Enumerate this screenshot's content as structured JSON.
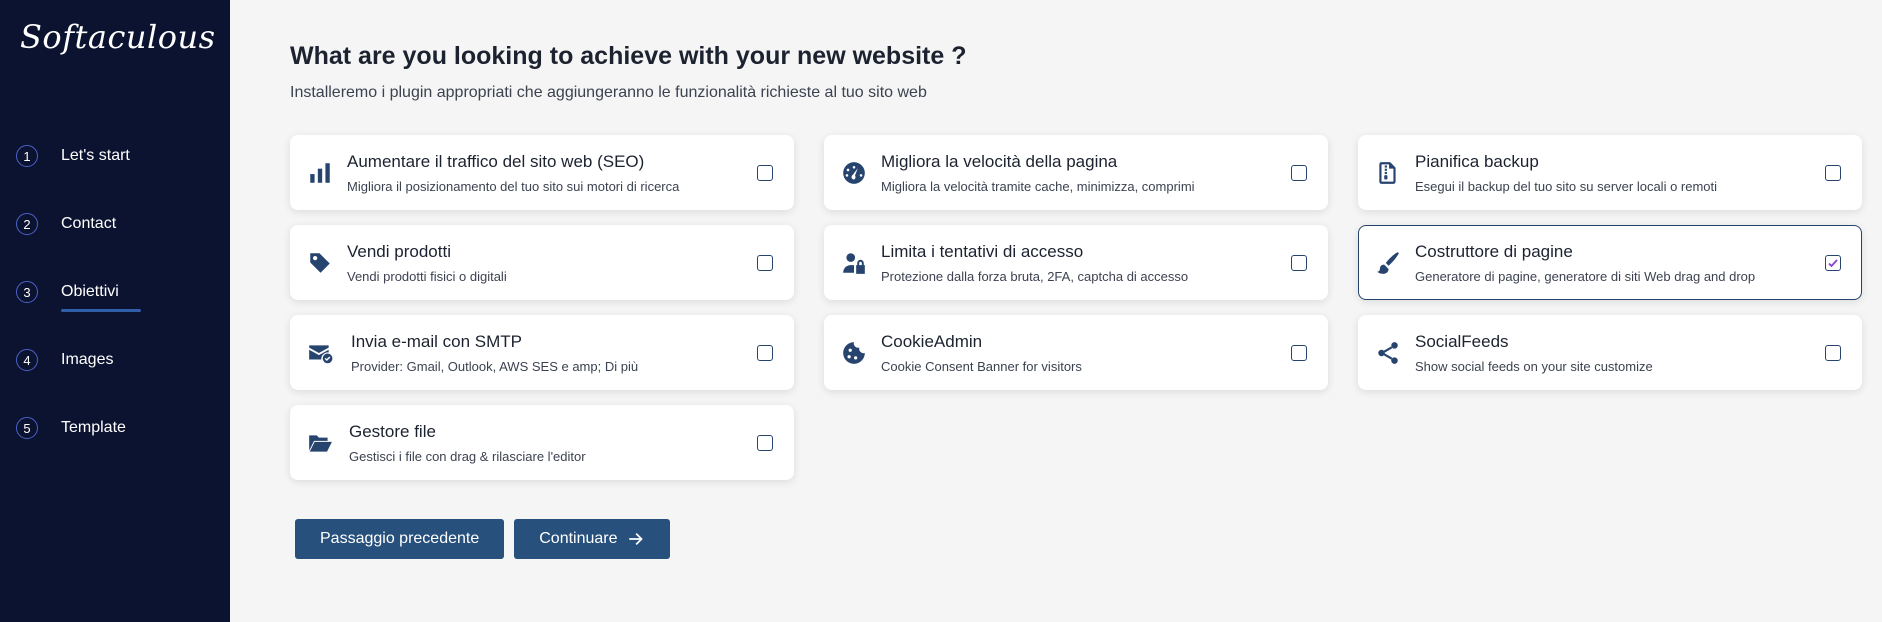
{
  "sidebar": {
    "logo": "Softaculous",
    "steps": [
      {
        "num": "1",
        "label": "Let's start"
      },
      {
        "num": "2",
        "label": "Contact"
      },
      {
        "num": "3",
        "label": "Obiettivi"
      },
      {
        "num": "4",
        "label": "Images"
      },
      {
        "num": "5",
        "label": "Template"
      }
    ],
    "active_step": "Obiettivi"
  },
  "main": {
    "title": "What are you looking to achieve with your new website ?",
    "subtitle": "Installeremo i plugin appropriati che aggiungeranno le funzionalità richieste al tuo sito web",
    "options": [
      {
        "title": "Aumentare il traffico del sito web (SEO)",
        "desc": "Migliora il posizionamento del tuo sito sui motori di ricerca",
        "icon": "bar-chart-icon",
        "checked": false
      },
      {
        "title": "Migliora la velocità della pagina",
        "desc": "Migliora la velocità tramite cache, minimizza, comprimi",
        "icon": "speedometer-icon",
        "checked": false
      },
      {
        "title": "Pianifica backup",
        "desc": "Esegui il backup del tuo sito su server locali o remoti",
        "icon": "file-archive-icon",
        "checked": false
      },
      {
        "title": "Vendi prodotti",
        "desc": "Vendi prodotti fisici o digitali",
        "icon": "tag-icon",
        "checked": false
      },
      {
        "title": "Limita i tentativi di accesso",
        "desc": "Protezione dalla forza bruta, 2FA, captcha di accesso",
        "icon": "user-lock-icon",
        "checked": false
      },
      {
        "title": "Costruttore di pagine",
        "desc": "Generatore di pagine, generatore di siti Web drag and drop",
        "icon": "paintbrush-icon",
        "checked": true
      },
      {
        "title": "Invia e-mail con SMTP",
        "desc": "Provider: Gmail, Outlook, AWS SES e amp; Di più",
        "icon": "envelope-check-icon",
        "checked": false
      },
      {
        "title": "CookieAdmin",
        "desc": "Cookie Consent Banner for visitors",
        "icon": "cookie-icon",
        "checked": false
      },
      {
        "title": "SocialFeeds",
        "desc": "Show social feeds on your site customize",
        "icon": "share-icon",
        "checked": false
      },
      {
        "title": "Gestore file",
        "desc": "Gestisci i file con drag & rilasciare l'editor",
        "icon": "folder-open-icon",
        "checked": false
      }
    ],
    "buttons": {
      "prev": "Passaggio precedente",
      "next": "Continuare"
    }
  },
  "colors": {
    "sidebar_bg": "#0b1330",
    "accent": "#27446e",
    "button_bg": "#27507c",
    "page_bg": "#f4f5f4"
  }
}
